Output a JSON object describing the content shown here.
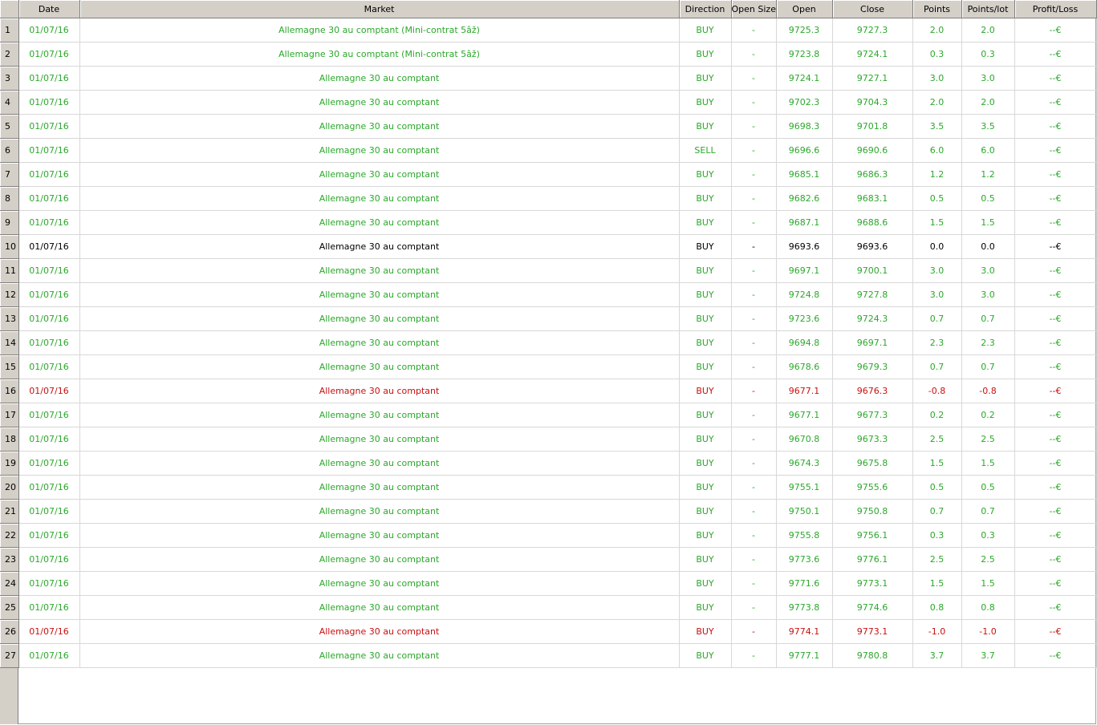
{
  "columns": [
    "Date",
    "Market",
    "Direction",
    "Open Size",
    "Open",
    "Close",
    "Points",
    "Points/lot",
    "Profit/Loss"
  ],
  "colors": {
    "win": "#2ba82b",
    "loss": "#c81010",
    "flat": "#000000",
    "header_bg": "#d4d0c8"
  },
  "rows": [
    {
      "n": "1",
      "status": "win",
      "cells": [
        "01/07/16",
        "Allemagne 30 au comptant (Mini-contrat 5âž)",
        "BUY",
        "-",
        "9725.3",
        "9727.3",
        "2.0",
        "2.0",
        "--€"
      ]
    },
    {
      "n": "2",
      "status": "win",
      "cells": [
        "01/07/16",
        "Allemagne 30 au comptant (Mini-contrat 5âž)",
        "BUY",
        "-",
        "9723.8",
        "9724.1",
        "0.3",
        "0.3",
        "--€"
      ]
    },
    {
      "n": "3",
      "status": "win",
      "cells": [
        "01/07/16",
        "Allemagne 30 au comptant",
        "BUY",
        "-",
        "9724.1",
        "9727.1",
        "3.0",
        "3.0",
        "--€"
      ]
    },
    {
      "n": "4",
      "status": "win",
      "cells": [
        "01/07/16",
        "Allemagne 30 au comptant",
        "BUY",
        "-",
        "9702.3",
        "9704.3",
        "2.0",
        "2.0",
        "--€"
      ]
    },
    {
      "n": "5",
      "status": "win",
      "cells": [
        "01/07/16",
        "Allemagne 30 au comptant",
        "BUY",
        "-",
        "9698.3",
        "9701.8",
        "3.5",
        "3.5",
        "--€"
      ]
    },
    {
      "n": "6",
      "status": "win",
      "cells": [
        "01/07/16",
        "Allemagne 30 au comptant",
        "SELL",
        "-",
        "9696.6",
        "9690.6",
        "6.0",
        "6.0",
        "--€"
      ]
    },
    {
      "n": "7",
      "status": "win",
      "cells": [
        "01/07/16",
        "Allemagne 30 au comptant",
        "BUY",
        "-",
        "9685.1",
        "9686.3",
        "1.2",
        "1.2",
        "--€"
      ]
    },
    {
      "n": "8",
      "status": "win",
      "cells": [
        "01/07/16",
        "Allemagne 30 au comptant",
        "BUY",
        "-",
        "9682.6",
        "9683.1",
        "0.5",
        "0.5",
        "--€"
      ]
    },
    {
      "n": "9",
      "status": "win",
      "cells": [
        "01/07/16",
        "Allemagne 30 au comptant",
        "BUY",
        "-",
        "9687.1",
        "9688.6",
        "1.5",
        "1.5",
        "--€"
      ]
    },
    {
      "n": "10",
      "status": "flat",
      "cells": [
        "01/07/16",
        "Allemagne 30 au comptant",
        "BUY",
        "-",
        "9693.6",
        "9693.6",
        "0.0",
        "0.0",
        "--€"
      ]
    },
    {
      "n": "11",
      "status": "win",
      "cells": [
        "01/07/16",
        "Allemagne 30 au comptant",
        "BUY",
        "-",
        "9697.1",
        "9700.1",
        "3.0",
        "3.0",
        "--€"
      ]
    },
    {
      "n": "12",
      "status": "win",
      "cells": [
        "01/07/16",
        "Allemagne 30 au comptant",
        "BUY",
        "-",
        "9724.8",
        "9727.8",
        "3.0",
        "3.0",
        "--€"
      ]
    },
    {
      "n": "13",
      "status": "win",
      "cells": [
        "01/07/16",
        "Allemagne 30 au comptant",
        "BUY",
        "-",
        "9723.6",
        "9724.3",
        "0.7",
        "0.7",
        "--€"
      ]
    },
    {
      "n": "14",
      "status": "win",
      "cells": [
        "01/07/16",
        "Allemagne 30 au comptant",
        "BUY",
        "-",
        "9694.8",
        "9697.1",
        "2.3",
        "2.3",
        "--€"
      ]
    },
    {
      "n": "15",
      "status": "win",
      "cells": [
        "01/07/16",
        "Allemagne 30 au comptant",
        "BUY",
        "-",
        "9678.6",
        "9679.3",
        "0.7",
        "0.7",
        "--€"
      ]
    },
    {
      "n": "16",
      "status": "loss",
      "cells": [
        "01/07/16",
        "Allemagne 30 au comptant",
        "BUY",
        "-",
        "9677.1",
        "9676.3",
        "-0.8",
        "-0.8",
        "--€"
      ]
    },
    {
      "n": "17",
      "status": "win",
      "cells": [
        "01/07/16",
        "Allemagne 30 au comptant",
        "BUY",
        "-",
        "9677.1",
        "9677.3",
        "0.2",
        "0.2",
        "--€"
      ]
    },
    {
      "n": "18",
      "status": "win",
      "cells": [
        "01/07/16",
        "Allemagne 30 au comptant",
        "BUY",
        "-",
        "9670.8",
        "9673.3",
        "2.5",
        "2.5",
        "--€"
      ]
    },
    {
      "n": "19",
      "status": "win",
      "cells": [
        "01/07/16",
        "Allemagne 30 au comptant",
        "BUY",
        "-",
        "9674.3",
        "9675.8",
        "1.5",
        "1.5",
        "--€"
      ]
    },
    {
      "n": "20",
      "status": "win",
      "cells": [
        "01/07/16",
        "Allemagne 30 au comptant",
        "BUY",
        "-",
        "9755.1",
        "9755.6",
        "0.5",
        "0.5",
        "--€"
      ]
    },
    {
      "n": "21",
      "status": "win",
      "cells": [
        "01/07/16",
        "Allemagne 30 au comptant",
        "BUY",
        "-",
        "9750.1",
        "9750.8",
        "0.7",
        "0.7",
        "--€"
      ]
    },
    {
      "n": "22",
      "status": "win",
      "cells": [
        "01/07/16",
        "Allemagne 30 au comptant",
        "BUY",
        "-",
        "9755.8",
        "9756.1",
        "0.3",
        "0.3",
        "--€"
      ]
    },
    {
      "n": "23",
      "status": "win",
      "cells": [
        "01/07/16",
        "Allemagne 30 au comptant",
        "BUY",
        "-",
        "9773.6",
        "9776.1",
        "2.5",
        "2.5",
        "--€"
      ]
    },
    {
      "n": "24",
      "status": "win",
      "cells": [
        "01/07/16",
        "Allemagne 30 au comptant",
        "BUY",
        "-",
        "9771.6",
        "9773.1",
        "1.5",
        "1.5",
        "--€"
      ]
    },
    {
      "n": "25",
      "status": "win",
      "cells": [
        "01/07/16",
        "Allemagne 30 au comptant",
        "BUY",
        "-",
        "9773.8",
        "9774.6",
        "0.8",
        "0.8",
        "--€"
      ]
    },
    {
      "n": "26",
      "status": "loss",
      "cells": [
        "01/07/16",
        "Allemagne 30 au comptant",
        "BUY",
        "-",
        "9774.1",
        "9773.1",
        "-1.0",
        "-1.0",
        "--€"
      ]
    },
    {
      "n": "27",
      "status": "win",
      "cells": [
        "01/07/16",
        "Allemagne 30 au comptant",
        "BUY",
        "-",
        "9777.1",
        "9780.8",
        "3.7",
        "3.7",
        "--€"
      ]
    }
  ]
}
